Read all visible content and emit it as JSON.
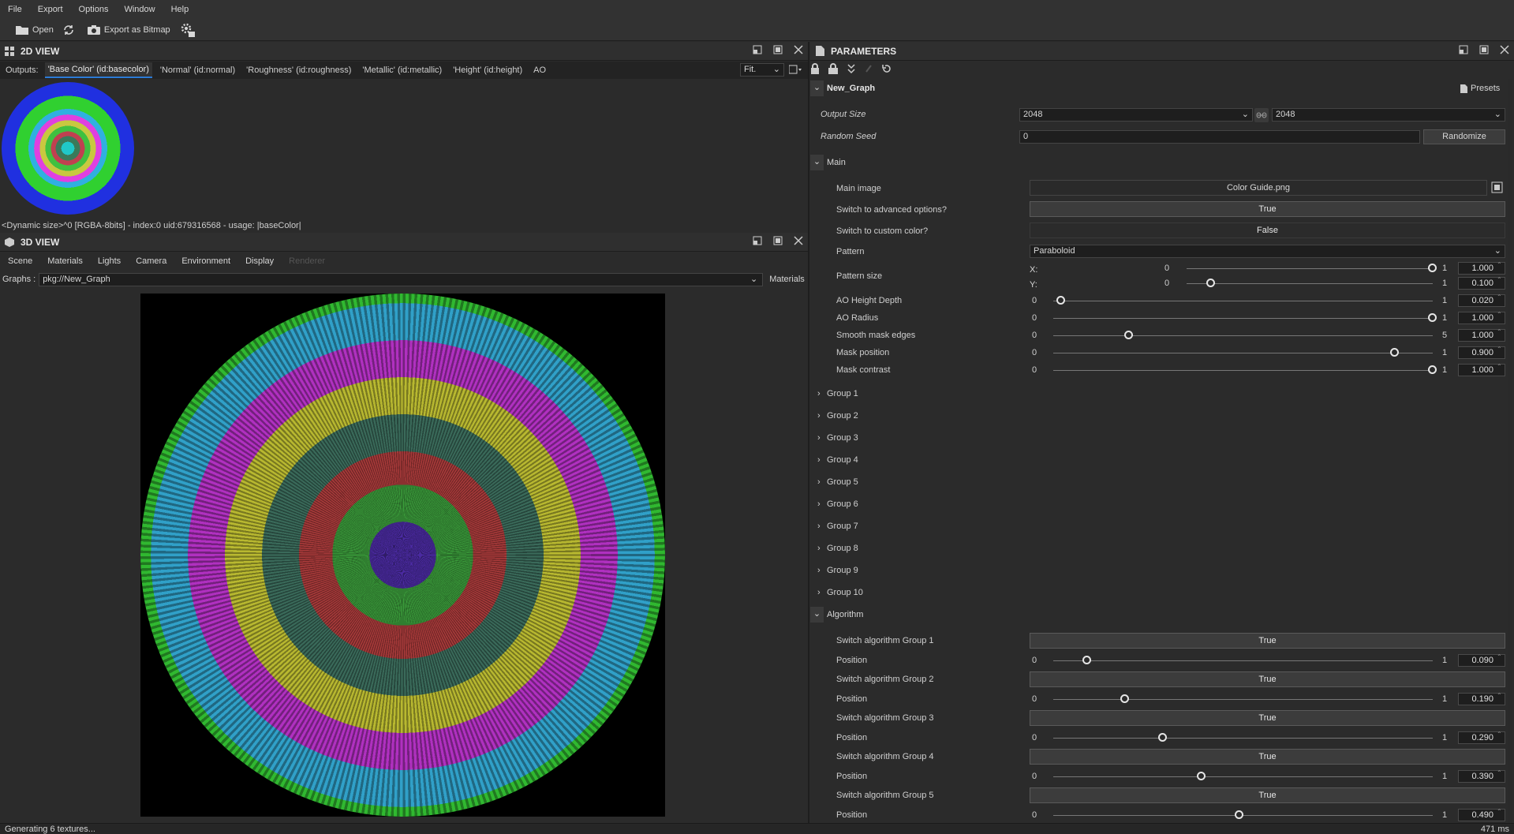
{
  "menu": [
    "File",
    "Export",
    "Options",
    "Window",
    "Help"
  ],
  "toolbar": {
    "open": "Open",
    "export_bitmap": "Export as Bitmap"
  },
  "view2d": {
    "title": "2D VIEW",
    "outputs_label": "Outputs:",
    "tabs": [
      "'Base Color' (id:basecolor)",
      "'Normal' (id:normal)",
      "'Roughness' (id:roughness)",
      "'Metallic' (id:metallic)",
      "'Height' (id:height)",
      "AO"
    ],
    "fit": "Fit.",
    "info": "<Dynamic size>^0 [RGBA-8bits] - index:0 uid:679316568 - usage: |baseColor|"
  },
  "view3d": {
    "title": "3D VIEW",
    "menu": [
      "Scene",
      "Materials",
      "Lights",
      "Camera",
      "Environment",
      "Display",
      "Renderer"
    ],
    "graphs_label": "Graphs :",
    "graph_value": "pkg://New_Graph",
    "materials": "Materials"
  },
  "status": {
    "left": "Generating 6 textures...",
    "right": "471 ms"
  },
  "params": {
    "title": "PARAMETERS",
    "graph": "New_Graph",
    "presets": "Presets",
    "output_size_label": "Output Size",
    "output_size_a": "2048",
    "output_size_b": "2048",
    "seed_label": "Random Seed",
    "seed": "0",
    "randomize": "Randomize",
    "main": "Main",
    "main_image_label": "Main image",
    "main_image": "Color Guide.png",
    "adv_label": "Switch to advanced options?",
    "adv": "True",
    "custom_label": "Switch to custom color?",
    "custom": "False",
    "pattern_label": "Pattern",
    "pattern": "Paraboloid",
    "pattern_size_label": "Pattern size",
    "px": "X:",
    "py": "Y:",
    "sliders": [
      {
        "label": "AO Height Depth",
        "min": "0",
        "max": "1",
        "value": "0.020",
        "frac": 0.02
      },
      {
        "label": "AO Radius",
        "min": "0",
        "max": "1",
        "value": "1.000",
        "frac": 1.0
      },
      {
        "label": "Smooth mask edges",
        "min": "0",
        "max": "5",
        "value": "1.000",
        "frac": 0.2
      },
      {
        "label": "Mask position",
        "min": "0",
        "max": "1",
        "value": "0.900",
        "frac": 0.9
      },
      {
        "label": "Mask contrast",
        "min": "0",
        "max": "1",
        "value": "1.000",
        "frac": 1.0
      }
    ],
    "pattern_size": {
      "x": {
        "min": "0",
        "max": "1",
        "value": "1.000",
        "frac": 1.0
      },
      "y": {
        "min": "0",
        "max": "1",
        "value": "0.100",
        "frac": 0.1
      }
    },
    "groups": [
      "Group 1",
      "Group 2",
      "Group 3",
      "Group 4",
      "Group 5",
      "Group 6",
      "Group 7",
      "Group 8",
      "Group 9",
      "Group 10"
    ],
    "algorithm": "Algorithm",
    "algo": [
      {
        "switch_label": "Switch algorithm Group 1",
        "switch": "True",
        "pos_label": "Position",
        "min": "0",
        "max": "1",
        "value": "0.090",
        "frac": 0.09
      },
      {
        "switch_label": "Switch algorithm Group 2",
        "switch": "True",
        "pos_label": "Position",
        "min": "0",
        "max": "1",
        "value": "0.190",
        "frac": 0.19
      },
      {
        "switch_label": "Switch algorithm Group 3",
        "switch": "True",
        "pos_label": "Position",
        "min": "0",
        "max": "1",
        "value": "0.290",
        "frac": 0.29
      },
      {
        "switch_label": "Switch algorithm Group 4",
        "switch": "True",
        "pos_label": "Position",
        "min": "0",
        "max": "1",
        "value": "0.390",
        "frac": 0.39
      },
      {
        "switch_label": "Switch algorithm Group 5",
        "switch": "True",
        "pos_label": "Position",
        "min": "0",
        "max": "1",
        "value": "0.490",
        "frac": 0.49
      }
    ]
  }
}
